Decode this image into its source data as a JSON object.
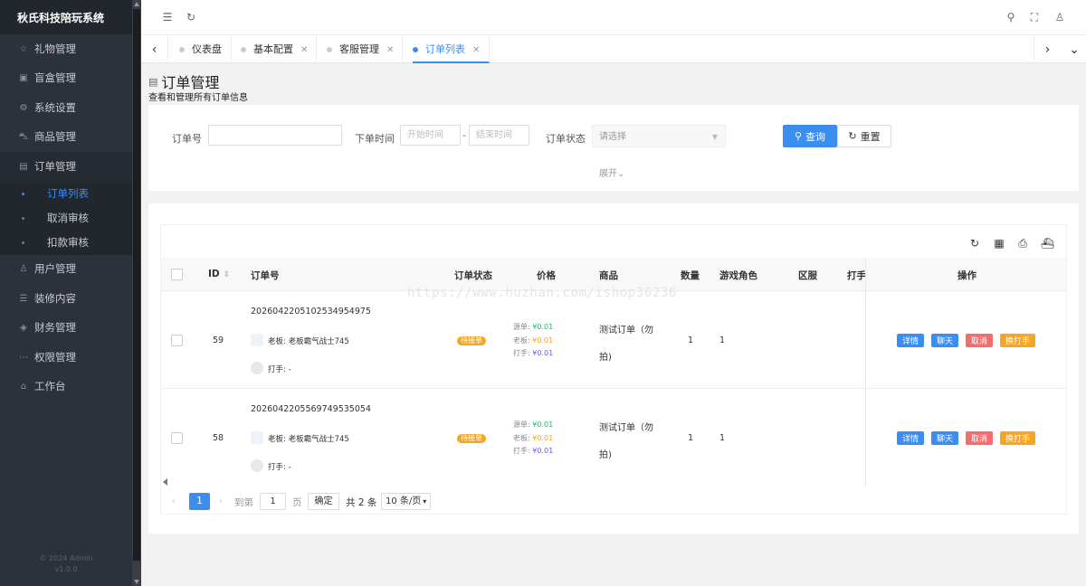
{
  "app": {
    "title": "秋氏科技陪玩系统",
    "footer_line1": "© 2024 Admin",
    "footer_line2": "v1.0.0"
  },
  "sidebar": {
    "items": [
      {
        "label": "礼物管理",
        "icon": "gift-icon"
      },
      {
        "label": "盲盒管理",
        "icon": "box-icon"
      },
      {
        "label": "系统设置",
        "icon": "gear-icon"
      },
      {
        "label": "商品管理",
        "icon": "cart-icon"
      },
      {
        "label": "订单管理",
        "icon": "order-icon"
      },
      {
        "label": "用户管理",
        "icon": "user-icon"
      },
      {
        "label": "装修内容",
        "icon": "list-icon"
      },
      {
        "label": "财务管理",
        "icon": "finance-icon"
      },
      {
        "label": "权限管理",
        "icon": "ellipsis-icon"
      },
      {
        "label": "工作台",
        "icon": "home-icon"
      }
    ],
    "order_sub": [
      "订单列表",
      "取消审核",
      "扣款审核"
    ]
  },
  "tabs": [
    {
      "label": "仪表盘"
    },
    {
      "label": "基本配置"
    },
    {
      "label": "客服管理"
    },
    {
      "label": "订单列表"
    }
  ],
  "page": {
    "title": "订单管理",
    "subtitle": "查看和管理所有订单信息"
  },
  "search": {
    "order_no_label": "订单号",
    "order_no_value": "",
    "time_label": "下单时间",
    "start_placeholder": "开始时间",
    "dash": "-",
    "end_placeholder": "结束时间",
    "status_label": "订单状态",
    "status_placeholder": "请选择",
    "query_label": "查询",
    "reset_label": "重置",
    "expand_label": "展开"
  },
  "table": {
    "headers": [
      "ID",
      "订单号",
      "订单状态",
      "价格",
      "商品",
      "数量",
      "游戏角色",
      "区服",
      "打手",
      "操作"
    ],
    "rows": [
      {
        "id": "59",
        "order_no": "20260422051025349549​75",
        "boss": "老板: 老板霸气战士745",
        "player": "打手: -",
        "status": "待接单",
        "price_src_label": "源单:",
        "price_src": "¥0.01",
        "price_boss_label": "老板:",
        "price_boss": "¥0.01",
        "price_player_label": "打手:",
        "price_player": "¥0.01",
        "product_line1": "测试订单（勿",
        "product_line2": "拍)",
        "qty": "1",
        "role": "1"
      },
      {
        "id": "58",
        "order_no": "20260422055697495350​54",
        "boss": "老板: 老板霸气战士745",
        "player": "打手: -",
        "status": "待接单",
        "price_src_label": "源单:",
        "price_src": "¥0.01",
        "price_boss_label": "老板:",
        "price_boss": "¥0.01",
        "price_player_label": "打手:",
        "price_player": "¥0.01",
        "product_line1": "测试订单（勿",
        "product_line2": "拍)",
        "qty": "1",
        "role": "1"
      }
    ],
    "actions": {
      "detail": "详情",
      "chat": "聊天",
      "cancel": "取消",
      "swap": "换打手"
    }
  },
  "pagination": {
    "current": "1",
    "goto_label": "到第",
    "goto_value": "1",
    "page_label": "页",
    "confirm": "确定",
    "total": "共 2 条",
    "size": "10 条/页"
  },
  "watermark": "https://www.huzhan.com/ishop36236",
  "colors": {
    "primary": "#3b8ef0",
    "badge": "#f5a623",
    "cancel": "#f56c6c",
    "swap": "#f5a623",
    "green": "#19be6b",
    "orange": "#f5a623",
    "purple": "#6b5bf0",
    "sidebar": "#2c313a"
  }
}
